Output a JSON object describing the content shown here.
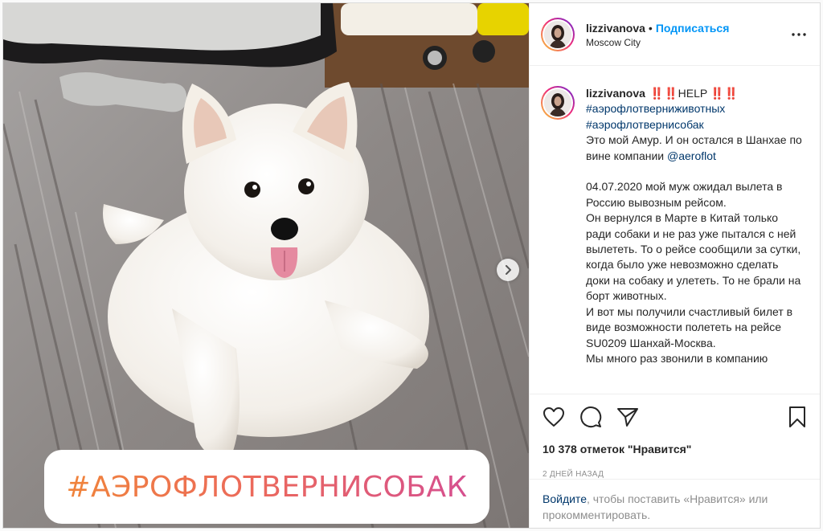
{
  "post": {
    "username": "lizzivanova",
    "separator": "•",
    "follow_label": "Подписаться",
    "location": "Moscow City",
    "more_icon": "more-horizontal-icon",
    "image_overlay_text": "#АЭРОФЛОТВЕРНИСОБАК",
    "carousel_next_icon": "chevron-right-icon"
  },
  "caption": {
    "username": "lizzivanova",
    "first_line": " ‼️‼️HELP ‼️‼️",
    "hashtag_1": "#аэрофлотверниживотных",
    "hashtag_2": "#аэрофлотвернисобак",
    "text_1": "Это мой Амур. И он остался в Шанхае по вине компании ",
    "mention": "@aeroflot",
    "text_2": "04.07.2020 мой муж ожидал вылета в Россию вывозным рейсом.",
    "text_3": "Он вернулся в Марте в Китай только ради собаки и не раз уже пытался с ней вылететь. То о рейсе сообщили за сутки, когда было уже невозможно сделать доки на собаку и улететь. То не брали на борт животных.",
    "text_4": "И вот мы получили счастливый билет в виде возможности полететь на рейсе SU0209 Шанхай-Москва.",
    "text_5": "Мы много раз звонили в компанию"
  },
  "actions": {
    "like_icon": "heart-icon",
    "comment_icon": "comment-icon",
    "share_icon": "send-icon",
    "save_icon": "bookmark-icon",
    "likes_text": "10 378 отметок \"Нравится\"",
    "time_text": "2 дней назад"
  },
  "login": {
    "link": "Войдите",
    "text": ", чтобы поставить «Нравится» или прокомментировать."
  },
  "colors": {
    "accent": "#0095f6",
    "link": "#00376b",
    "muted": "#8e8e8e"
  }
}
